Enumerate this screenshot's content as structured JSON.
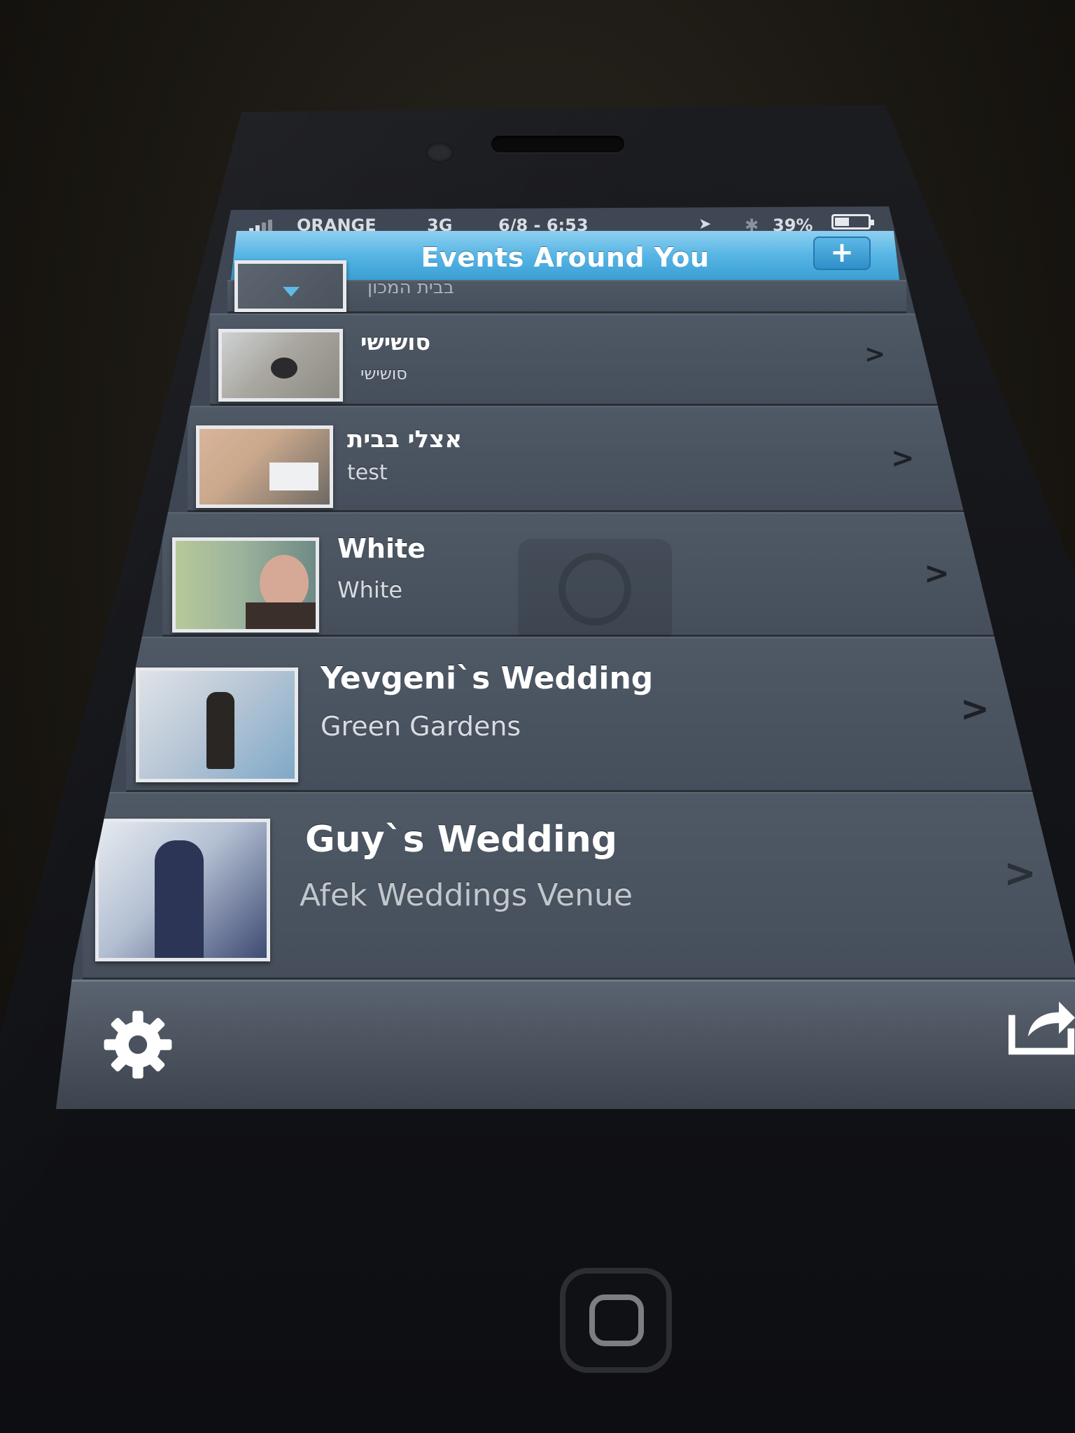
{
  "status_bar": {
    "carrier": "ORANGE",
    "network": "3G",
    "datetime": "6/8 - 6:53",
    "battery": "39%"
  },
  "nav": {
    "title": "Events Around You",
    "add_label": "+"
  },
  "events": [
    {
      "title": "",
      "subtitle": "בבית המכון",
      "chevron": ">",
      "thumb_colors": [
        "#5d6570",
        "#4b535e"
      ]
    },
    {
      "title": "סושישי",
      "subtitle": "סושישי",
      "chevron": ">",
      "thumb_colors": [
        "#cfd2d4",
        "#8d8a82"
      ]
    },
    {
      "title": "אצלי בבית",
      "subtitle": "test",
      "chevron": ">",
      "thumb_colors": [
        "#c9a88c",
        "#6e6a64"
      ]
    },
    {
      "title": "White",
      "subtitle": "White",
      "chevron": ">",
      "thumb_colors": [
        "#b7c89a",
        "#6f8a86"
      ]
    },
    {
      "title": "Yevgeni`s Wedding",
      "subtitle": "Green Gardens",
      "chevron": ">",
      "thumb_colors": [
        "#dfe3e8",
        "#7fa9c8"
      ]
    },
    {
      "title": "Guy`s Wedding",
      "subtitle": "Afek Weddings Venue",
      "chevron": ">",
      "thumb_colors": [
        "#e6eaf0",
        "#3e4b73"
      ]
    }
  ],
  "toolbar": {
    "settings_icon": "gear-icon",
    "share_icon": "share-icon"
  },
  "colors": {
    "nav_accent": "#56b5e4",
    "row_bg": "#4f5966",
    "text": "#ffffff"
  }
}
